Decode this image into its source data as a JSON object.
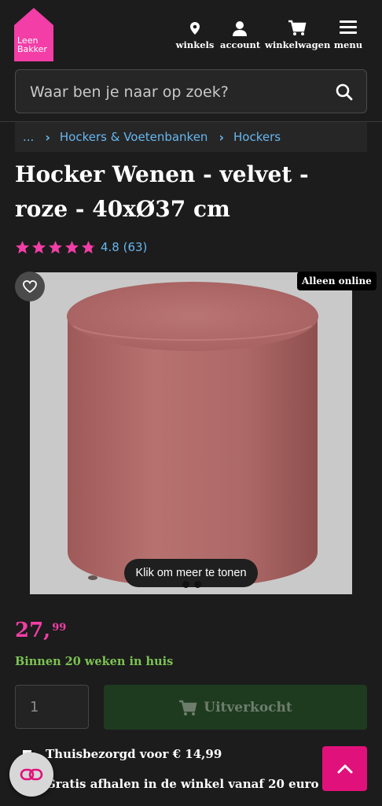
{
  "header": {
    "logo": {
      "text_line1": "Leen",
      "text_line2": "Bakker",
      "color": "#f23ea6"
    },
    "nav": [
      {
        "label": "winkels",
        "icon": "map-pin-icon"
      },
      {
        "label": "account",
        "icon": "user-icon"
      },
      {
        "label": "winkelwagen",
        "icon": "shopping-cart-icon"
      },
      {
        "label": "menu",
        "icon": "hamburger-menu-icon"
      }
    ]
  },
  "search": {
    "placeholder": "Waar ben je naar op zoek?",
    "value": "",
    "icon": "search-icon"
  },
  "breadcrumb": {
    "ellipsis": "...",
    "items": [
      "Hockers & Voetenbanken",
      "Hockers"
    ]
  },
  "product": {
    "title": "Hocker Wenen - velvet - roze - 40xØ37 cm",
    "rating": {
      "stars": 4.8,
      "max": 5,
      "text": "4.8 (63)",
      "star_color": "#f23ea6"
    },
    "badge": "Alleen online",
    "more_label": "Klik om meer te tonen",
    "price": {
      "main": "27,",
      "cents": "99",
      "color": "#f23ea6"
    },
    "delivery_time": "Binnen 20 weken in huis",
    "quantity": "1",
    "soldout_label": "Uitverkocht"
  },
  "shipping": [
    {
      "icon": "truck-icon",
      "text": "Thuisbezorgd voor € 14,99"
    },
    {
      "icon": "store-icon",
      "text": "Gratis afhalen in de winkel vanaf 20 euro"
    }
  ],
  "floating": {
    "chat_icon": "chat-link-icon",
    "top_icon": "chevron-up-icon",
    "top_color": "#e0117a"
  }
}
